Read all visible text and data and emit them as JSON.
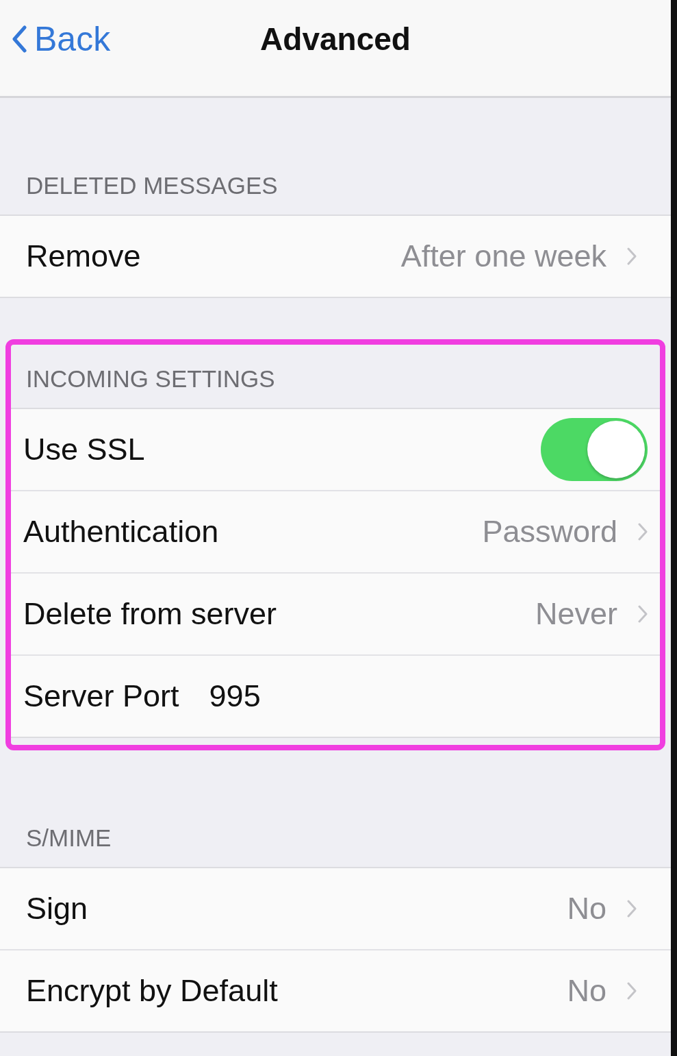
{
  "nav": {
    "back": "Back",
    "title": "Advanced"
  },
  "sections": [
    {
      "header": "DELETED MESSAGES",
      "highlighted": false,
      "rows": [
        {
          "kind": "value",
          "label": "Remove",
          "value": "After one week"
        }
      ]
    },
    {
      "header": "INCOMING SETTINGS",
      "highlighted": true,
      "rows": [
        {
          "kind": "toggle",
          "label": "Use SSL",
          "on": true
        },
        {
          "kind": "value",
          "label": "Authentication",
          "value": "Password"
        },
        {
          "kind": "value",
          "label": "Delete from server",
          "value": "Never"
        },
        {
          "kind": "field",
          "label": "Server Port",
          "value": "995"
        }
      ]
    },
    {
      "header": "S/MIME",
      "highlighted": false,
      "rows": [
        {
          "kind": "value",
          "label": "Sign",
          "value": "No"
        },
        {
          "kind": "value",
          "label": "Encrypt by Default",
          "value": "No"
        }
      ]
    }
  ]
}
